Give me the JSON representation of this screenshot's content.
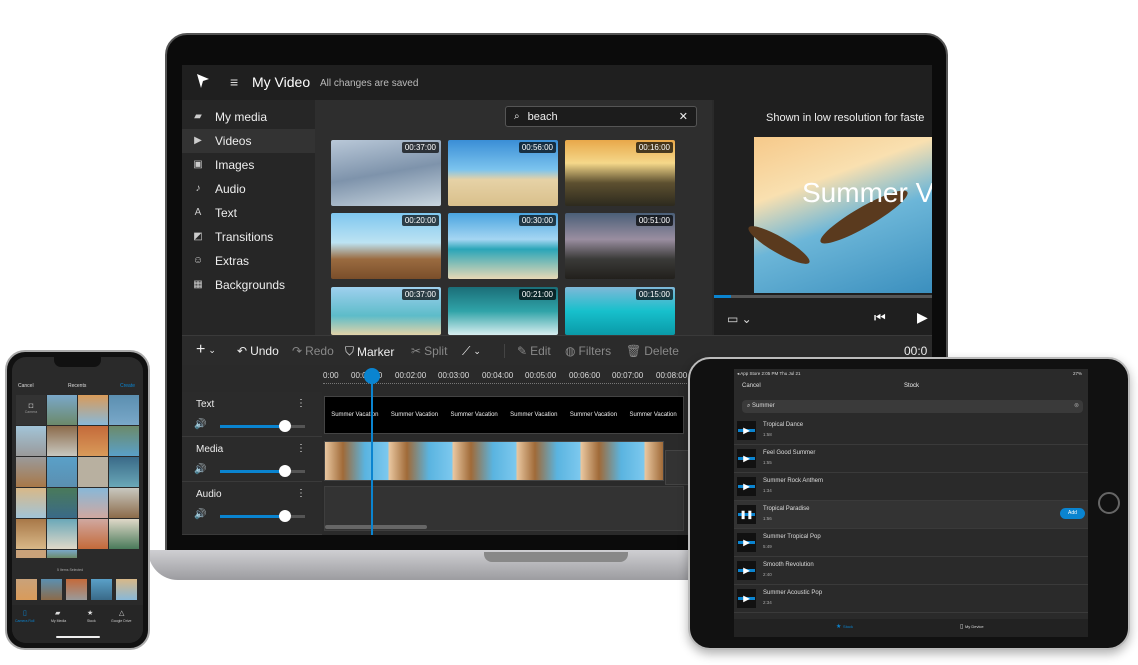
{
  "laptop": {
    "project_title": "My Video",
    "save_status": "All changes are saved",
    "sidebar": {
      "items": [
        {
          "label": "My media",
          "icon": "folder-icon"
        },
        {
          "label": "Videos",
          "icon": "video-icon"
        },
        {
          "label": "Images",
          "icon": "image-icon"
        },
        {
          "label": "Audio",
          "icon": "music-note-icon"
        },
        {
          "label": "Text",
          "icon": "text-icon"
        },
        {
          "label": "Transitions",
          "icon": "transition-icon"
        },
        {
          "label": "Extras",
          "icon": "smiley-icon"
        },
        {
          "label": "Backgrounds",
          "icon": "background-icon"
        }
      ],
      "selected": "Videos"
    },
    "search": {
      "value": "beach"
    },
    "videos": [
      {
        "duration": "00:37:00"
      },
      {
        "duration": "00:56:00"
      },
      {
        "duration": "00:16:00"
      },
      {
        "duration": "00:20:00"
      },
      {
        "duration": "00:30:00"
      },
      {
        "duration": "00:51:00"
      },
      {
        "duration": "00:37:00"
      },
      {
        "duration": "00:21:00"
      },
      {
        "duration": "00:15:00"
      }
    ],
    "preview": {
      "notice": "Shown in low resolution for faste",
      "overlay_text": "Summer V"
    },
    "toolbar": {
      "undo": "Undo",
      "redo": "Redo",
      "marker": "Marker",
      "split": "Split",
      "edit": "Edit",
      "filters": "Filters",
      "delete": "Delete",
      "time": "00:0"
    },
    "ruler": [
      "0:00",
      "00:01:00",
      "00:02:00",
      "00:03:00",
      "00:04:00",
      "00:05:00",
      "00:06:00",
      "00:07:00",
      "00:08:00"
    ],
    "tracks": [
      {
        "label": "Text",
        "volume": 0.75
      },
      {
        "label": "Media",
        "volume": 0.75
      },
      {
        "label": "Audio",
        "volume": 0.75
      }
    ],
    "text_clips": [
      "Summer Vacation",
      "Summer Vacation",
      "Summer Vacation",
      "Summer Vacation",
      "Summer Vacation",
      "Summer Vacation"
    ],
    "accent": "#0a84d0"
  },
  "tablet": {
    "status": {
      "left": "◂ App Store  2:05 PM  Thu Jul 21",
      "right": "27%"
    },
    "cancel": "Cancel",
    "title": "Stock",
    "search_value": "Summer",
    "songs": [
      {
        "title": "Tropical Dance",
        "duration": "1:58"
      },
      {
        "title": "Feel Good Summer",
        "duration": "1:55"
      },
      {
        "title": "Summer Rock Anthem",
        "duration": "1:34"
      },
      {
        "title": "Tropical Paradise",
        "duration": "1:56",
        "playing": true
      },
      {
        "title": "Summer Tropical Pop",
        "duration": "5:49"
      },
      {
        "title": "Smooth Revolution",
        "duration": "2:40"
      },
      {
        "title": "Summer Acoustic Pop",
        "duration": "2:34"
      }
    ],
    "add_label": "Add",
    "tabs": [
      "Stock",
      "My Device"
    ]
  },
  "phone": {
    "cancel": "Cancel",
    "title": "Recents",
    "create": "Create",
    "camera_label": "Camera",
    "selected_count": "5 Items Selected",
    "tabs": [
      "Camera Roll",
      "My Media",
      "Stock",
      "Google Drive"
    ]
  }
}
